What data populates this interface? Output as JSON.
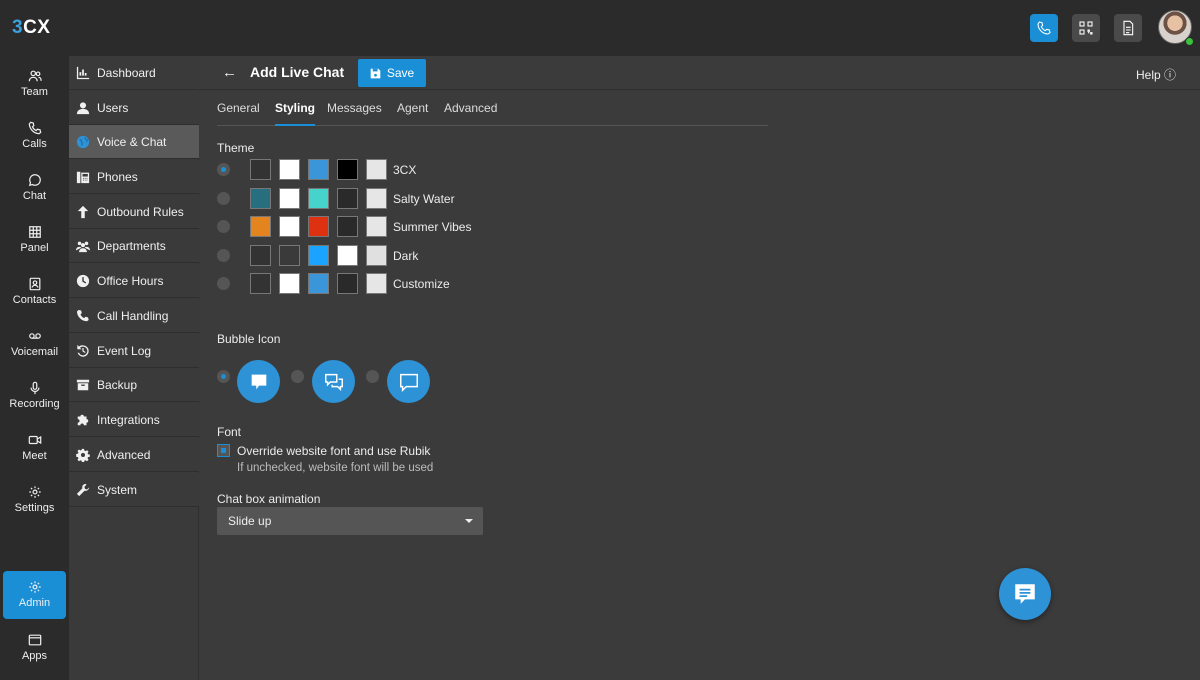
{
  "app": {
    "logo": "3CX",
    "logo_prefix": "3",
    "logo_suffix": "CX"
  },
  "topbar": {
    "buttons": [
      {
        "icon": "phone-icon",
        "active": true
      },
      {
        "icon": "qr-code-icon",
        "active": false
      },
      {
        "icon": "document-icon",
        "active": false
      }
    ]
  },
  "rail": {
    "items": [
      {
        "label": "Team",
        "icon": "team-icon"
      },
      {
        "label": "Calls",
        "icon": "phone-icon"
      },
      {
        "label": "Chat",
        "icon": "chat-icon"
      },
      {
        "label": "Panel",
        "icon": "grid-icon"
      },
      {
        "label": "Contacts",
        "icon": "contacts-icon"
      },
      {
        "label": "Voicemail",
        "icon": "voicemail-icon"
      },
      {
        "label": "Recording",
        "icon": "microphone-icon"
      },
      {
        "label": "Meet",
        "icon": "video-icon"
      },
      {
        "label": "Settings",
        "icon": "gear-icon"
      },
      {
        "label": "Admin",
        "icon": "gear-icon",
        "active": true
      },
      {
        "label": "Apps",
        "icon": "window-icon"
      }
    ]
  },
  "nav": {
    "items": [
      {
        "label": "Dashboard",
        "icon": "dashboard-icon"
      },
      {
        "label": "Users",
        "icon": "user-icon"
      },
      {
        "label": "Voice & Chat",
        "icon": "globe-icon",
        "active": true
      },
      {
        "label": "Phones",
        "icon": "desk-phone-icon"
      },
      {
        "label": "Outbound Rules",
        "icon": "arrow-up-icon"
      },
      {
        "label": "Departments",
        "icon": "group-icon"
      },
      {
        "label": "Office Hours",
        "icon": "clock-icon"
      },
      {
        "label": "Call Handling",
        "icon": "handset-icon"
      },
      {
        "label": "Event Log",
        "icon": "history-icon"
      },
      {
        "label": "Backup",
        "icon": "archive-icon"
      },
      {
        "label": "Integrations",
        "icon": "puzzle-icon"
      },
      {
        "label": "Advanced",
        "icon": "cog-icon"
      },
      {
        "label": "System",
        "icon": "wrench-icon"
      }
    ]
  },
  "header": {
    "back": "←",
    "title": "Add Live Chat",
    "save_label": "Save",
    "help_label": "Help ⓘ"
  },
  "tabs": [
    {
      "label": "General"
    },
    {
      "label": "Styling",
      "active": true
    },
    {
      "label": "Messages"
    },
    {
      "label": "Agent"
    },
    {
      "label": "Advanced"
    }
  ],
  "theme": {
    "label": "Theme",
    "options": [
      {
        "name": "3CX",
        "selected": true,
        "swatches": [
          "#333333",
          "#ffffff",
          "#3a96d8",
          "#000000",
          "#e6e6e6"
        ]
      },
      {
        "name": "Salty Water",
        "selected": false,
        "swatches": [
          "#276f7e",
          "#ffffff",
          "#46d3cc",
          "#2a2a2a",
          "#e6e6e6"
        ]
      },
      {
        "name": "Summer Vibes",
        "selected": false,
        "swatches": [
          "#e3841f",
          "#ffffff",
          "#dd3112",
          "#2a2a2a",
          "#e6e6e6"
        ]
      },
      {
        "name": "Dark",
        "selected": false,
        "swatches": [
          "#333333",
          "#3a3a3a",
          "#1aa3ff",
          "#ffffff",
          "#e0e0e0"
        ]
      },
      {
        "name": "Customize",
        "selected": false,
        "swatches": [
          "#333333",
          "#ffffff",
          "#3a96d8",
          "#2a2a2a",
          "#e6e6e6"
        ]
      }
    ]
  },
  "bubble_icon": {
    "label": "Bubble Icon",
    "options": [
      {
        "icon": "chat-bubble-filled-icon",
        "selected": true
      },
      {
        "icon": "chat-bubbles-double-icon",
        "selected": false
      },
      {
        "icon": "chat-bubble-outline-icon",
        "selected": false
      }
    ]
  },
  "font": {
    "label": "Font",
    "checkbox_label": "Override website font and use Rubik",
    "checked": true,
    "hint": "If unchecked, website font will be used"
  },
  "animation": {
    "label": "Chat box animation",
    "value": "Slide up"
  },
  "colors": {
    "accent": "#1a8fd6",
    "bubble": "#2d92d6"
  }
}
